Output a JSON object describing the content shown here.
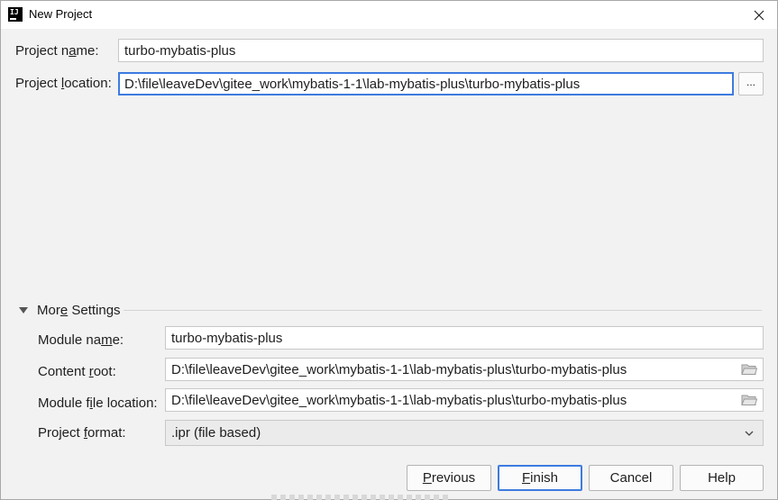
{
  "window": {
    "title": "New Project",
    "app_icon_text": "IJ"
  },
  "project": {
    "name_label_pre": "Project n",
    "name_label_mnemonic": "a",
    "name_label_post": "me:",
    "name_value": "turbo-mybatis-plus",
    "location_label_pre": "Project ",
    "location_label_mnemonic": "l",
    "location_label_post": "ocation:",
    "location_value": "D:\\file\\leaveDev\\gitee_work\\mybatis-1-1\\lab-mybatis-plus\\turbo-mybatis-plus",
    "browse_label": "..."
  },
  "more_settings": {
    "header_pre": "Mor",
    "header_mnemonic": "e",
    "header_post": " Settings",
    "module_name_label_pre": "Module na",
    "module_name_label_mnemonic": "m",
    "module_name_label_post": "e:",
    "module_name_value": "turbo-mybatis-plus",
    "content_root_label_pre": "Content ",
    "content_root_label_mnemonic": "r",
    "content_root_label_post": "oot:",
    "content_root_value": "D:\\file\\leaveDev\\gitee_work\\mybatis-1-1\\lab-mybatis-plus\\turbo-mybatis-plus",
    "module_file_label_pre": "Module f",
    "module_file_label_mnemonic": "i",
    "module_file_label_post": "le location:",
    "module_file_value": "D:\\file\\leaveDev\\gitee_work\\mybatis-1-1\\lab-mybatis-plus\\turbo-mybatis-plus",
    "format_label_pre": "Project ",
    "format_label_mnemonic": "f",
    "format_label_post": "ormat:",
    "format_value": ".ipr (file based)"
  },
  "buttons": {
    "previous_mnemonic": "P",
    "previous_rest": "revious",
    "finish_mnemonic": "F",
    "finish_rest": "inish",
    "cancel": "Cancel",
    "help": "Help"
  },
  "colors": {
    "accent": "#3d7be0",
    "background": "#f2f2f2",
    "titlebar": "#ffffff"
  }
}
